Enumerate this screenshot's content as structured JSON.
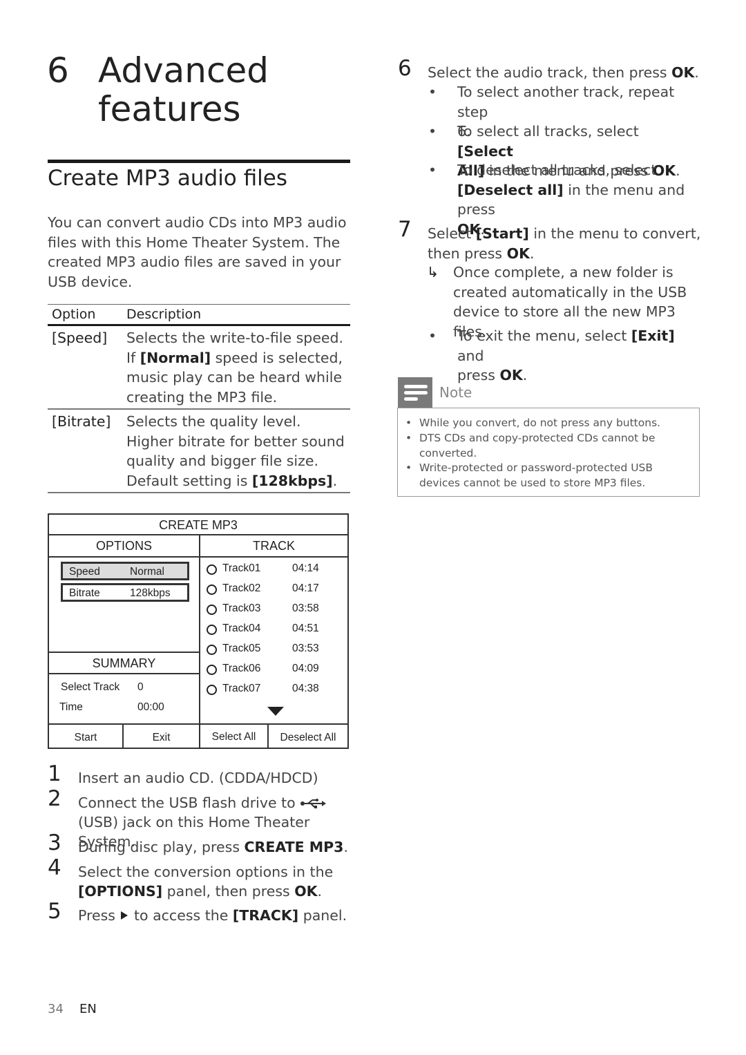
{
  "chapter": {
    "number": "6",
    "title_line1": "Advanced",
    "title_line2": "features"
  },
  "section": {
    "title": "Create MP3 audio files",
    "intro": "You can convert audio CDs into MP3 audio files with this Home Theater System. The created MP3 audio files are saved in your USB device."
  },
  "options_table": {
    "headers": [
      "Option",
      "Description"
    ],
    "rows": [
      {
        "option": "[Speed]",
        "desc_pre": "Selects the write-to-file speed. If ",
        "desc_bold": "[Normal]",
        "desc_post": " speed is selected, music play can be heard while creating the MP3 file."
      },
      {
        "option": "[Bitrate]",
        "desc_pre": "Selects the quality level. Higher bitrate for better sound quality and bigger file size.",
        "desc_line2_pre": "Default setting is ",
        "desc_bold": "[128kbps]",
        "desc_post": "."
      }
    ]
  },
  "screen": {
    "title": "CREATE MP3",
    "options_header": "OPTIONS",
    "track_header": "TRACK",
    "options": [
      {
        "name": "Speed",
        "value": "Normal",
        "selected": true
      },
      {
        "name": "Bitrate",
        "value": "128kbps",
        "selected": false
      }
    ],
    "summary_header": "SUMMARY",
    "summary": [
      {
        "label": "Select Track",
        "value": "0"
      },
      {
        "label": "Time",
        "value": "00:00"
      }
    ],
    "tracks": [
      {
        "name": "Track01",
        "time": "04:14"
      },
      {
        "name": "Track02",
        "time": "04:17"
      },
      {
        "name": "Track03",
        "time": "03:58"
      },
      {
        "name": "Track04",
        "time": "04:51"
      },
      {
        "name": "Track05",
        "time": "03:53"
      },
      {
        "name": "Track06",
        "time": "04:09"
      },
      {
        "name": "Track07",
        "time": "04:38"
      }
    ],
    "buttons": {
      "start": "Start",
      "exit": "Exit",
      "select_all": "Select All",
      "deselect_all": "Deselect All"
    },
    "icons": {
      "scroll_down": "down-triangle-icon",
      "track_radio": "radio-circle-icon"
    }
  },
  "steps_left": [
    {
      "num": "1",
      "text": "Insert an audio CD. (CDDA/HDCD)"
    },
    {
      "num": "2",
      "text_pre": "Connect the USB flash drive to ",
      "icon": "usb-icon",
      "text_line2": "(USB) jack on this Home Theater System."
    },
    {
      "num": "3",
      "text_pre": "During disc play, press ",
      "bold": "CREATE MP3",
      "text_post": "."
    },
    {
      "num": "4",
      "text_line1": "Select the conversion options in the",
      "bold": "[OPTIONS]",
      "text_mid": " panel, then press ",
      "bold2": "OK",
      "text_post": "."
    },
    {
      "num": "5",
      "text_pre": "Press ",
      "icon": "play-triangle-icon",
      "text_mid": " to access the ",
      "bold": "[TRACK]",
      "text_post": " panel."
    }
  ],
  "steps_right": {
    "step6": {
      "num": "6",
      "text_pre": "Select the audio track, then press ",
      "bold": "OK",
      "text_post": ".",
      "bullets": [
        {
          "line1": "To select another track, repeat step",
          "line2": "6."
        },
        {
          "line1_pre": "To select all tracks, select ",
          "line1_bold": "[Select",
          "line2_bold": "All]",
          "line2_mid": " in the menu and press ",
          "line2_bold2": "OK",
          "line2_post": "."
        },
        {
          "line1": "To deselect all tracks, select",
          "line2_bold": "[Deselect all]",
          "line2_post": " in the menu and press",
          "line3_bold": "OK",
          "line3_post": "."
        }
      ]
    },
    "step7": {
      "num": "7",
      "line1_pre": "Select ",
      "line1_bold": "[Start]",
      "line1_post": " in the menu to convert,",
      "line2_pre": "then press ",
      "line2_bold": "OK",
      "line2_post": ".",
      "result": "Once complete, a new folder is created automatically in the USB device to store all the new MP3 files.",
      "result_icon": "result-arrow-icon",
      "bullet": {
        "line1_pre": "To exit the menu, select ",
        "line1_bold": "[Exit]",
        "line1_post": " and",
        "line2_pre": "press ",
        "line2_bold": "OK",
        "line2_post": "."
      }
    }
  },
  "note": {
    "label": "Note",
    "icon": "note-icon",
    "items": [
      "While you convert, do not press any buttons.",
      "DTS CDs and copy-protected CDs cannot be converted.",
      "Write-protected or password-protected USB devices cannot be used to store MP3 files."
    ]
  },
  "footer": {
    "page": "34",
    "lang": "EN"
  }
}
